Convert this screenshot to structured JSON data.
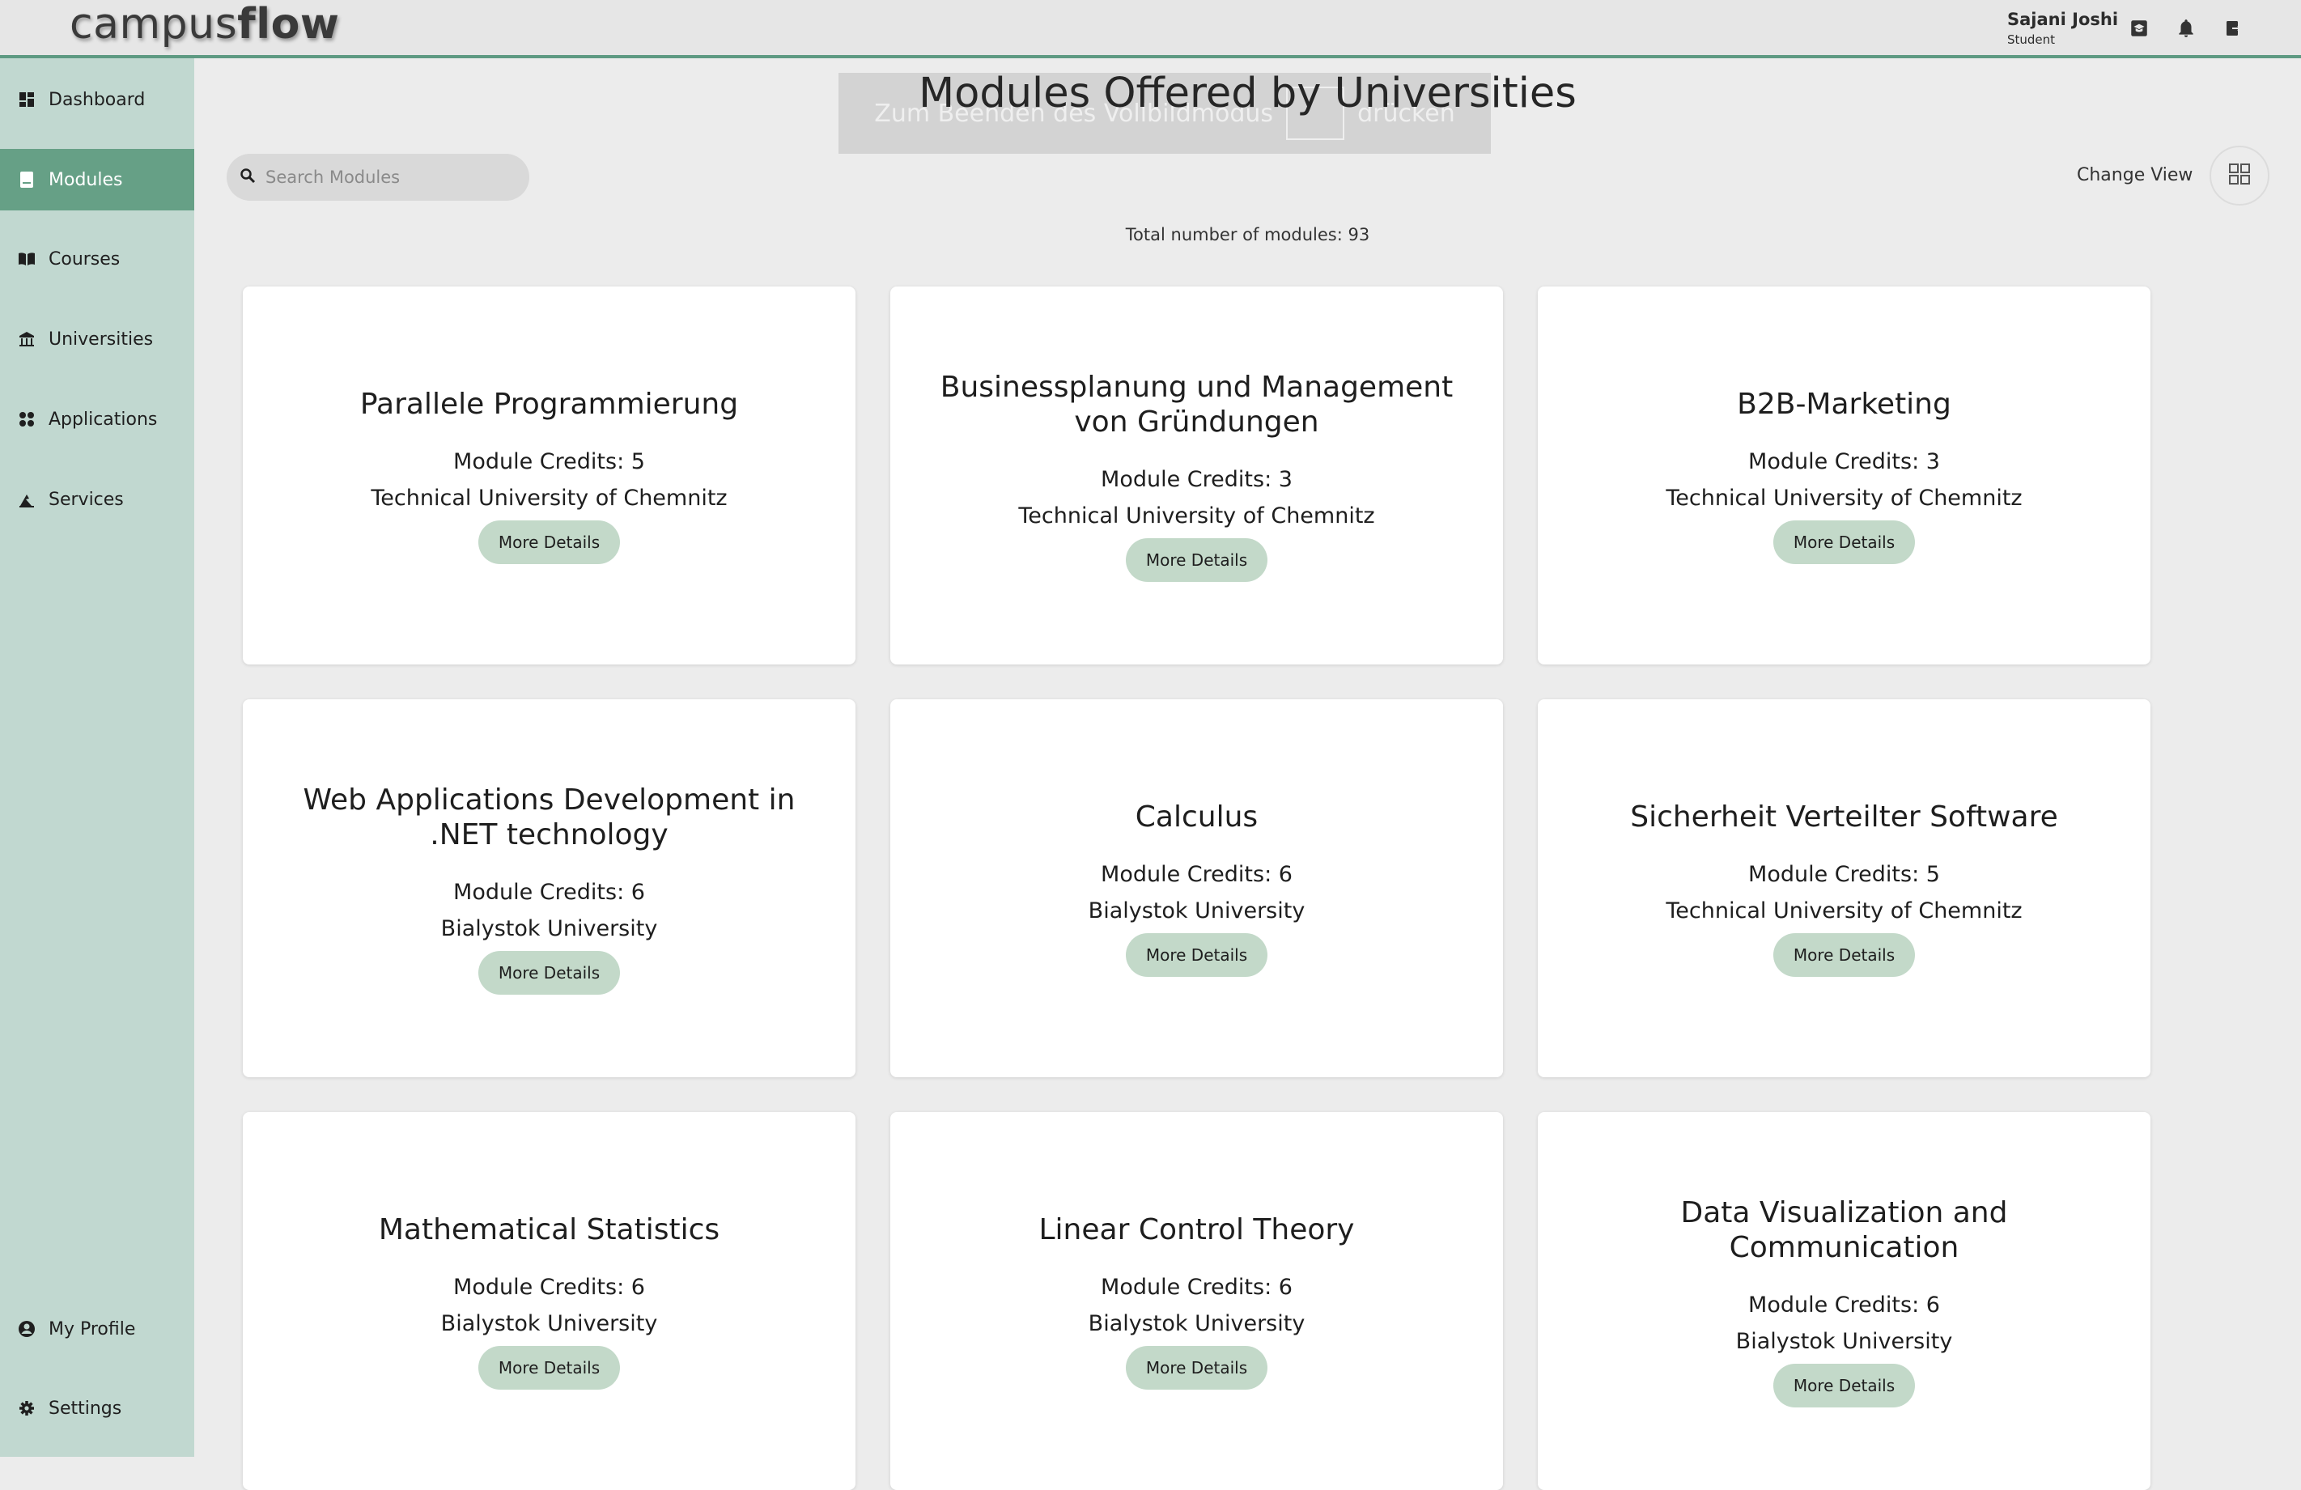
{
  "app": {
    "logo_light": "campus",
    "logo_bold": "flow"
  },
  "user": {
    "name": "Sajani Joshi",
    "role": "Student",
    "icons": [
      "graduation-cap-icon",
      "bell-icon",
      "logout-icon"
    ]
  },
  "sidebar": {
    "items": [
      {
        "label": "Dashboard",
        "icon": "dashboard-icon",
        "active": false
      },
      {
        "label": "Modules",
        "icon": "book-icon",
        "active": true
      },
      {
        "label": "Courses",
        "icon": "open-book-icon",
        "active": false
      },
      {
        "label": "Universities",
        "icon": "university-icon",
        "active": false
      },
      {
        "label": "Applications",
        "icon": "apps-icon",
        "active": false
      },
      {
        "label": "Services",
        "icon": "services-icon",
        "active": false
      }
    ],
    "bottom_items": [
      {
        "label": "My Profile",
        "icon": "user-circle-icon"
      },
      {
        "label": "Settings",
        "icon": "gear-icon"
      }
    ]
  },
  "overlay": {
    "text_before": "Zum Beenden des Vollbildmodus",
    "text_after": "drücken"
  },
  "main": {
    "title": "Modules Offered by Universities",
    "search_placeholder": "Search Modules",
    "change_view_label": "Change View",
    "total_text": "Total number of modules: 93"
  },
  "modules": [
    {
      "title": "Parallele Programmierung",
      "credits": "Module Credits: 5",
      "university": "Technical University of Chemnitz",
      "button": "More Details"
    },
    {
      "title": "Businessplanung und Management von Gründungen",
      "credits": "Module Credits: 3",
      "university": "Technical University of Chemnitz",
      "button": "More Details"
    },
    {
      "title": "B2B-Marketing",
      "credits": "Module Credits: 3",
      "university": "Technical University of Chemnitz",
      "button": "More Details"
    },
    {
      "title": "Web Applications Development in .NET technology",
      "credits": "Module Credits: 6",
      "university": "Bialystok University",
      "button": "More Details"
    },
    {
      "title": "Calculus",
      "credits": "Module Credits: 6",
      "university": "Bialystok University",
      "button": "More Details"
    },
    {
      "title": "Sicherheit Verteilter Software",
      "credits": "Module Credits: 5",
      "university": "Technical University of Chemnitz",
      "button": "More Details"
    },
    {
      "title": "Mathematical Statistics",
      "credits": "Module Credits: 6",
      "university": "Bialystok University",
      "button": "More Details"
    },
    {
      "title": "Linear Control Theory",
      "credits": "Module Credits: 6",
      "university": "Bialystok University",
      "button": "More Details"
    },
    {
      "title": "Data Visualization and Communication",
      "credits": "Module Credits: 6",
      "university": "Bialystok University",
      "button": "More Details"
    }
  ],
  "colors": {
    "accent": "#5e9a82",
    "sidebar_bg": "#c1d8d0",
    "sidebar_active": "#66a086",
    "button_bg": "#c3d9c9"
  }
}
